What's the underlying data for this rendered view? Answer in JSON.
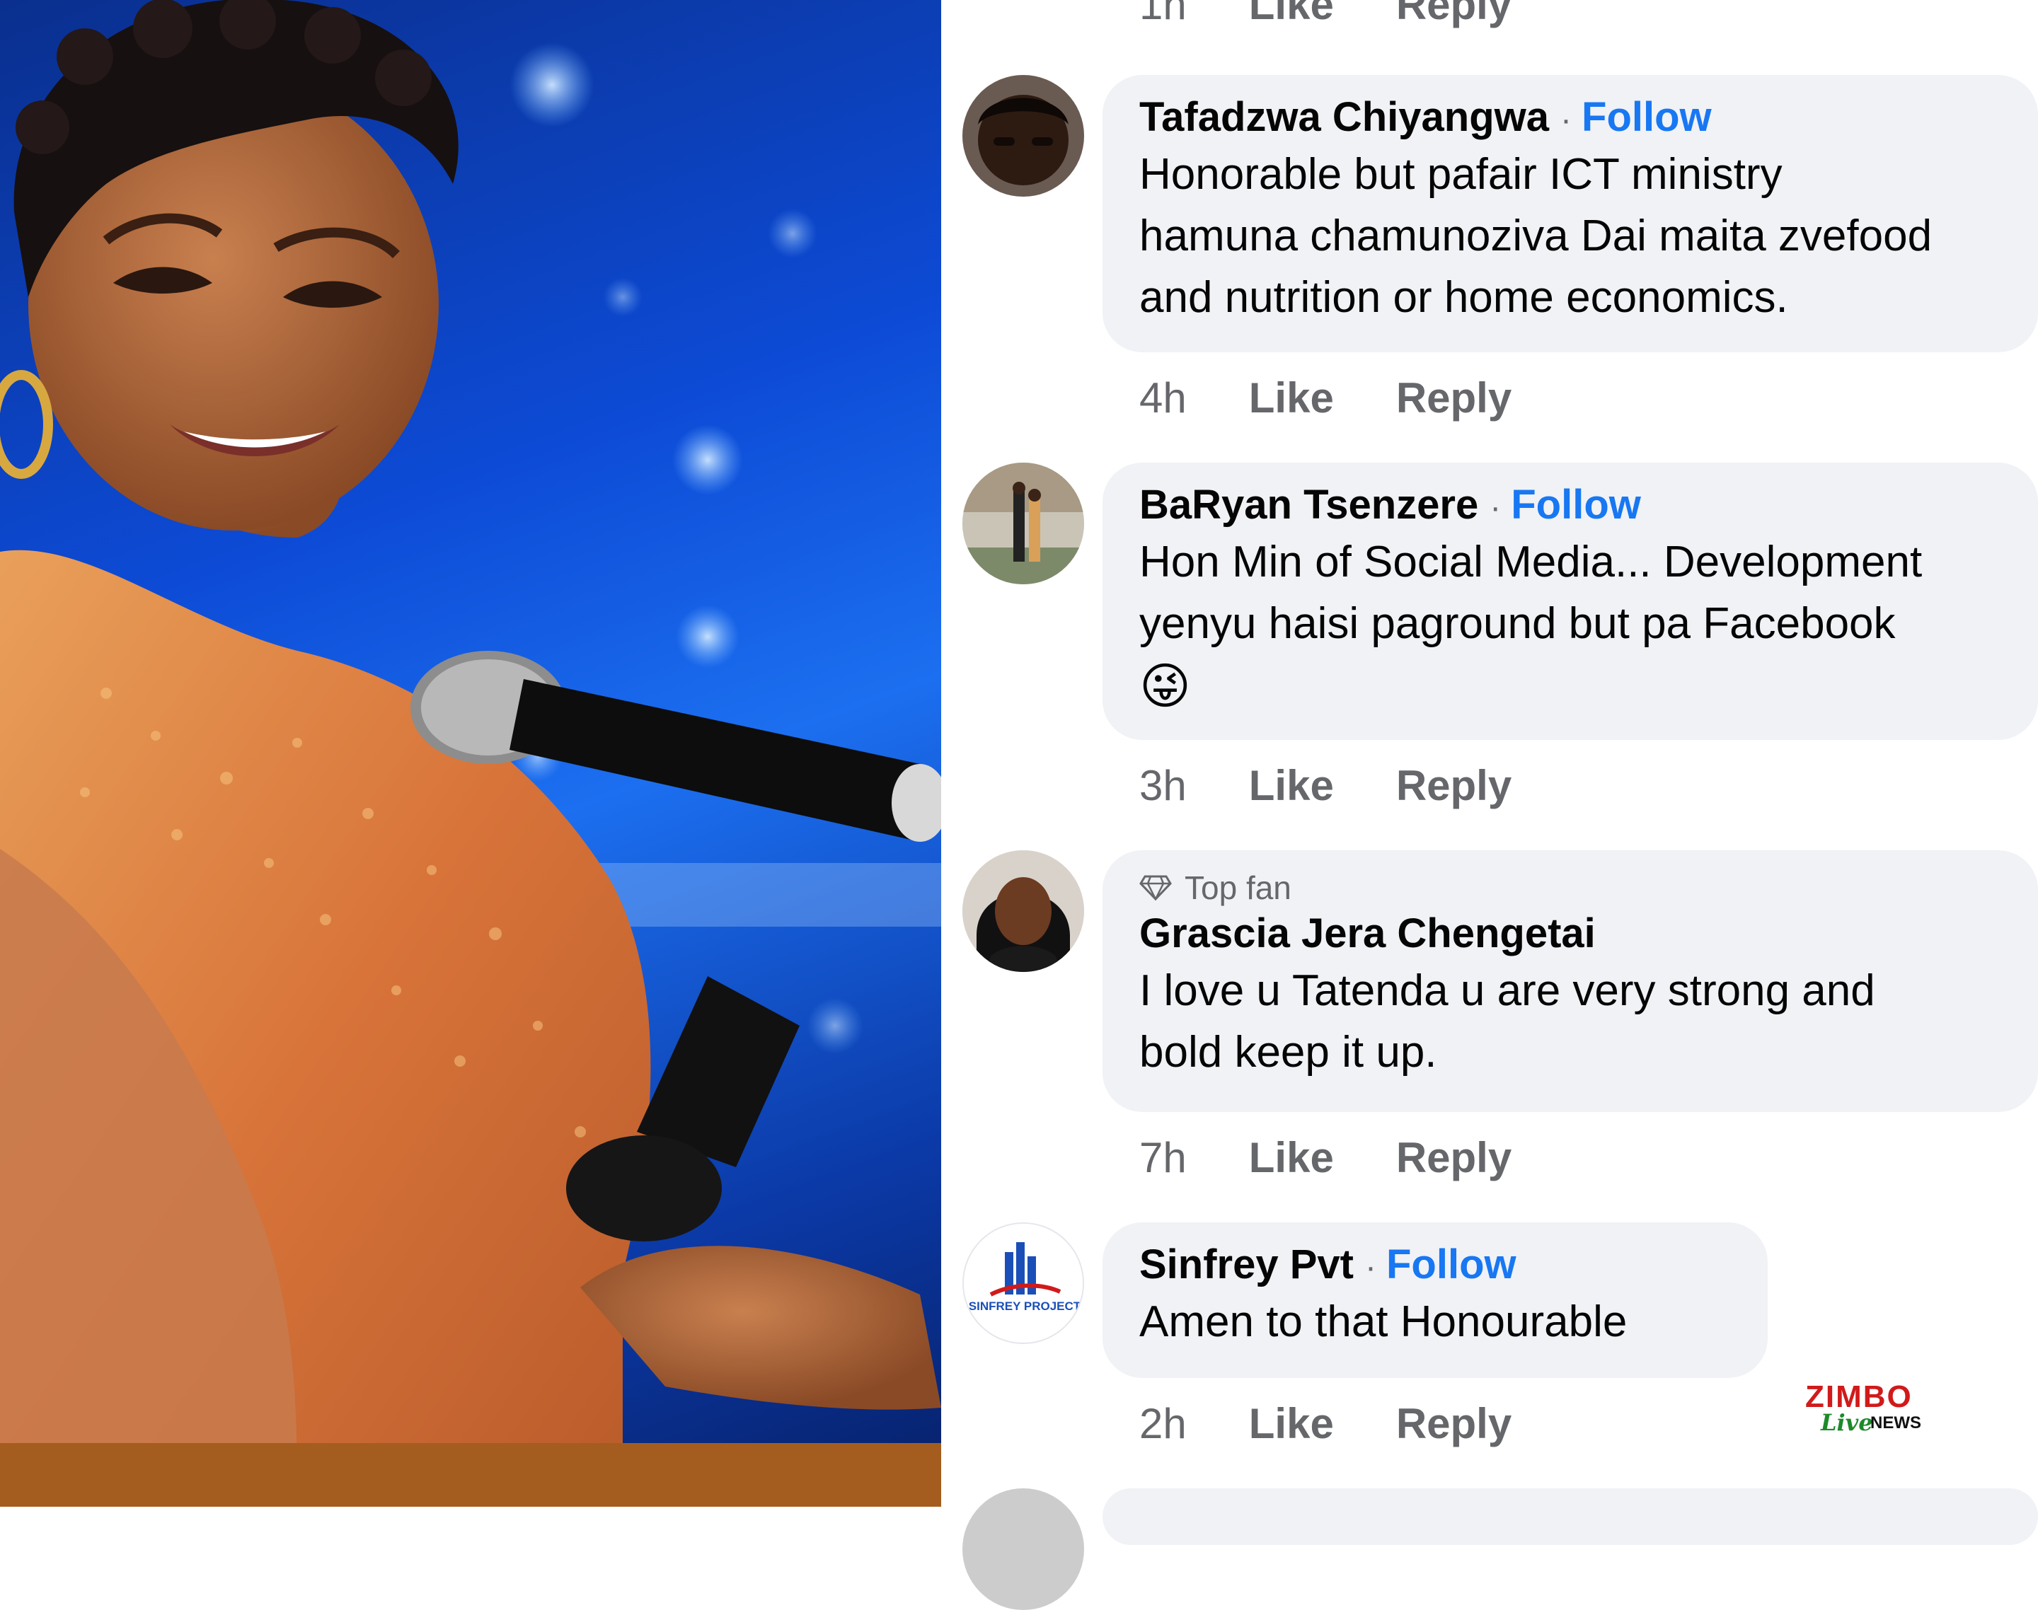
{
  "previous_meta": {
    "time": "1h",
    "like": "Like",
    "reply": "Reply"
  },
  "comments": [
    {
      "name": "Tafadzwa Chiyangwa",
      "follow": "Follow",
      "lines": [
        "Honorable but pafair ICT ministry",
        "hamuna chamunoziva Dai maita zvefood",
        "and nutrition or home economics."
      ],
      "time": "4h",
      "like": "Like",
      "reply": "Reply"
    },
    {
      "name": "BaRyan Tsenzere",
      "follow": "Follow",
      "lines": [
        "Hon Min of Social Media... Development",
        "yenyu haisi paground but pa Facebook"
      ],
      "emoji": "😜",
      "time": "3h",
      "like": "Like",
      "reply": "Reply"
    },
    {
      "badge": "Top fan",
      "name": "Grascia Jera Chengetai",
      "lines": [
        "I love u Tatenda u are very strong and",
        "bold keep it up."
      ],
      "time": "7h",
      "like": "Like",
      "reply": "Reply"
    },
    {
      "name": "Sinfrey Pvt",
      "follow": "Follow",
      "lines": [
        "Amen to that Honourable"
      ],
      "avatar_text": "SINFREY PROJECT",
      "time": "2h",
      "like": "Like",
      "reply": "Reply"
    }
  ],
  "watermark": {
    "brand": "ZIMBO",
    "live": "Live",
    "news": "NEWS"
  },
  "colors": {
    "follow": "#1877f2",
    "bubble": "#f0f2f5",
    "meta": "#65676b",
    "photo_bg": "#0d4bd6"
  }
}
